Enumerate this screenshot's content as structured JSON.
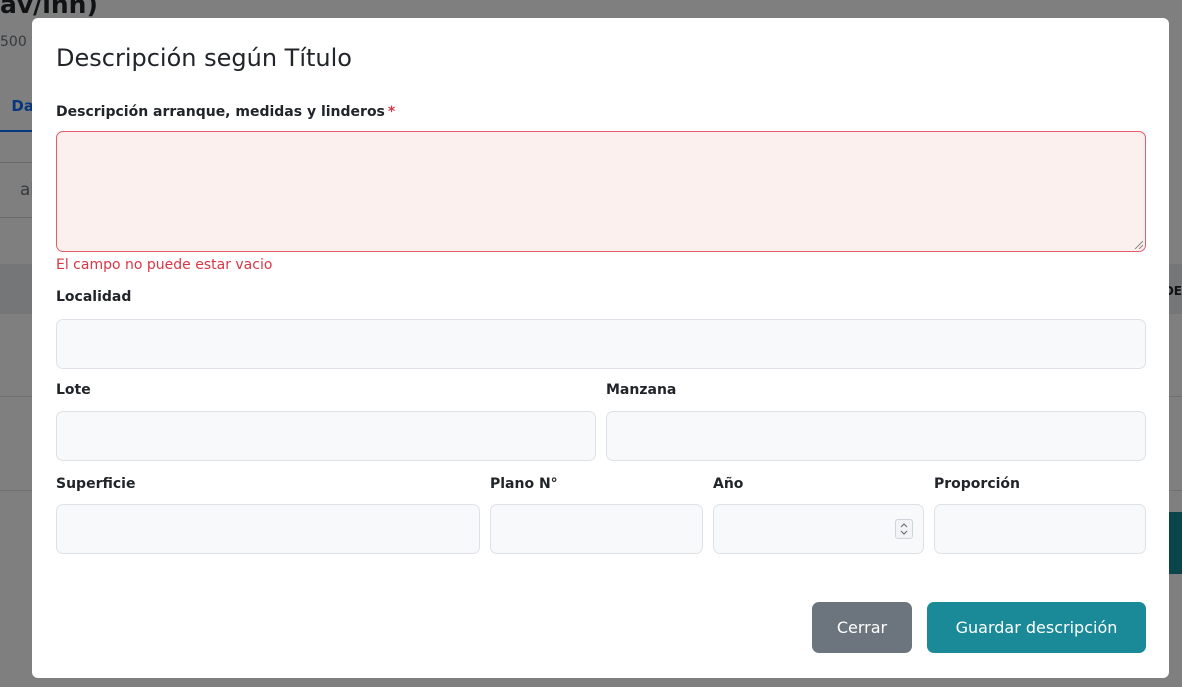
{
  "background": {
    "title_fragment": "av/inn)",
    "subtitle_fragment": "500",
    "tab_fragment": "Da",
    "input_fragment": "al",
    "column_fragment": "DE"
  },
  "modal": {
    "title": "Descripción según Título",
    "description_field": {
      "label": "Descripción arranque, medidas y linderos",
      "required_marker": "*",
      "value": "",
      "error": "El campo no puede estar vacio"
    },
    "localidad": {
      "label": "Localidad",
      "value": ""
    },
    "lote": {
      "label": "Lote",
      "value": ""
    },
    "manzana": {
      "label": "Manzana",
      "value": ""
    },
    "superficie": {
      "label": "Superficie",
      "value": ""
    },
    "plano": {
      "label": "Plano N°",
      "value": ""
    },
    "anio": {
      "label": "Año",
      "value": ""
    },
    "proporcion": {
      "label": "Proporción",
      "value": ""
    },
    "buttons": {
      "close_label": "Cerrar",
      "save_label": "Guardar descripción"
    }
  },
  "colors": {
    "primary_teal": "#1a8a98",
    "secondary_gray": "#6c757d",
    "error_red": "#dc3545",
    "invalid_bg": "#fcf0ef"
  },
  "icons": {
    "textarea_resize": "resize-grip-icon",
    "year_spinner": "chevron-up-down-icon"
  }
}
